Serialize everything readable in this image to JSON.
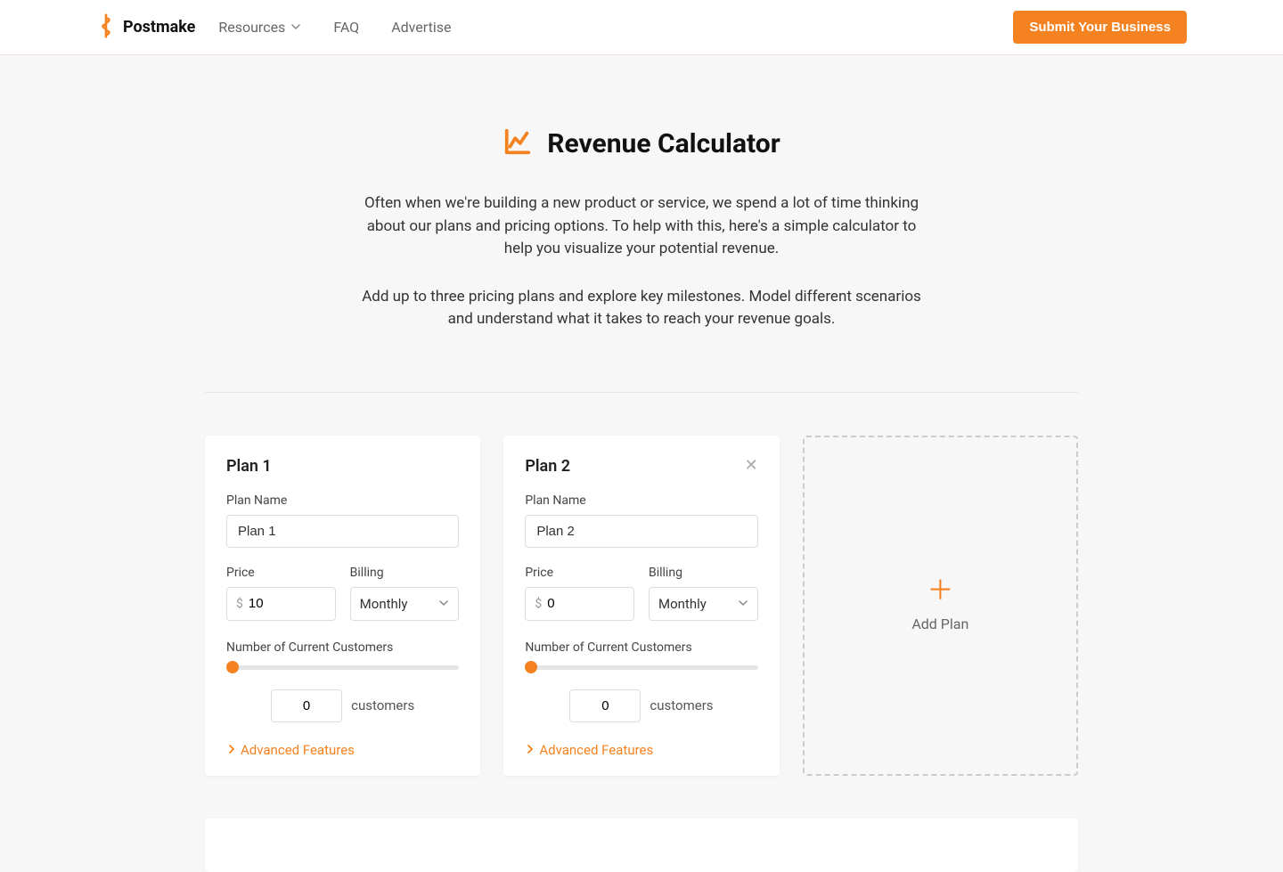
{
  "brand": {
    "name": "Postmake"
  },
  "nav": {
    "resources": "Resources",
    "faq": "FAQ",
    "advertise": "Advertise",
    "submit": "Submit Your Business"
  },
  "hero": {
    "title": "Revenue Calculator",
    "p1": "Often when we're building a new product or service, we spend a lot of time thinking about our plans and pricing options. To help with this, here's a simple calculator to help you visualize your potential revenue.",
    "p2": "Add up to three pricing plans and explore key milestones. Model different scenarios and understand what it takes to reach your revenue goals."
  },
  "labels": {
    "plan_name": "Plan Name",
    "price": "Price",
    "billing": "Billing",
    "customers_header": "Number of Current Customers",
    "customers_suffix": "customers",
    "advanced": "Advanced Features",
    "add_plan": "Add Plan",
    "currency": "$"
  },
  "plans": [
    {
      "title": "Plan 1",
      "name_value": "Plan 1",
      "price_value": "10",
      "billing_value": "Monthly",
      "customers_value": "0",
      "closable": false
    },
    {
      "title": "Plan 2",
      "name_value": "Plan 2",
      "price_value": "0",
      "billing_value": "Monthly",
      "customers_value": "0",
      "closable": true
    }
  ]
}
